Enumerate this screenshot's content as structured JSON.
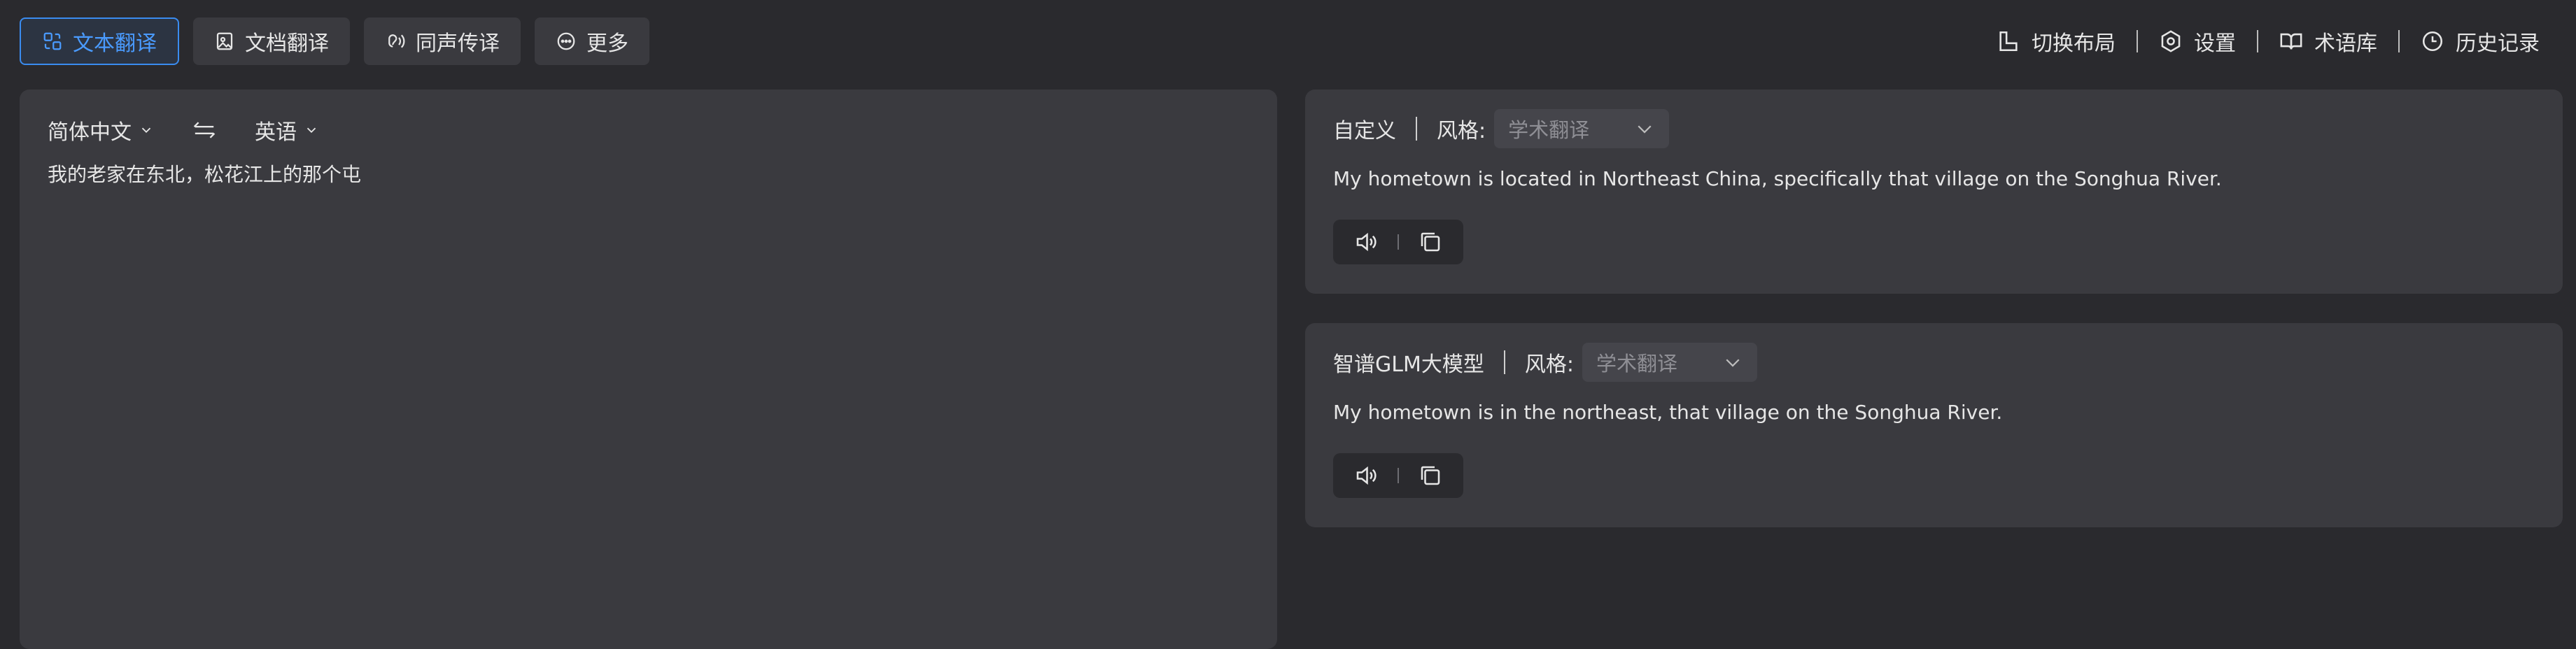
{
  "tabs": [
    {
      "label": "文本翻译",
      "icon": "text-translate-icon",
      "active": true
    },
    {
      "label": "文档翻译",
      "icon": "document-translate-icon",
      "active": false
    },
    {
      "label": "同声传译",
      "icon": "simultaneous-interpret-icon",
      "active": false
    },
    {
      "label": "更多",
      "icon": "more-icon",
      "active": false
    }
  ],
  "tools": [
    {
      "label": "切换布局",
      "icon": "layout-icon"
    },
    {
      "label": "设置",
      "icon": "gear-icon"
    },
    {
      "label": "术语库",
      "icon": "book-icon"
    },
    {
      "label": "历史记录",
      "icon": "clock-icon"
    }
  ],
  "input": {
    "source_lang": "简体中文",
    "target_lang": "英语",
    "text": "我的老家在东北，松花江上的那个屯"
  },
  "results": [
    {
      "engine": "自定义",
      "style_label": "风格:",
      "style_value": "学术翻译",
      "text": "My hometown is located in Northeast China, specifically that village on the Songhua River."
    },
    {
      "engine": "智谱GLM大模型",
      "style_label": "风格:",
      "style_value": "学术翻译",
      "text": "My hometown is in the northeast, that village on the Songhua River."
    }
  ],
  "colors": {
    "background": "#2a2a2e",
    "panel": "#3a3a3f",
    "accent": "#3a8cf0",
    "text": "#e6e6e6",
    "muted": "#8f8f95"
  }
}
